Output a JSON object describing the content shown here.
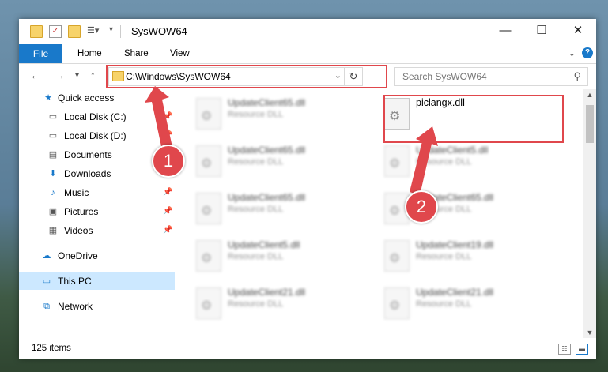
{
  "window": {
    "title": "SysWOW64"
  },
  "ribbon": {
    "tabs": [
      "File",
      "Home",
      "Share",
      "View"
    ]
  },
  "address": {
    "path": "C:\\Windows\\SysWOW64"
  },
  "search": {
    "placeholder": "Search SysWOW64"
  },
  "sidebar": {
    "items": [
      {
        "label": "Quick access",
        "icon": "star-icon"
      },
      {
        "label": "Local Disk (C:)",
        "icon": "drive-icon"
      },
      {
        "label": "Local Disk (D:)",
        "icon": "drive-icon"
      },
      {
        "label": "Documents",
        "icon": "document-icon"
      },
      {
        "label": "Downloads",
        "icon": "download-icon"
      },
      {
        "label": "Music",
        "icon": "music-icon"
      },
      {
        "label": "Pictures",
        "icon": "picture-icon"
      },
      {
        "label": "Videos",
        "icon": "video-icon"
      },
      {
        "label": "OneDrive",
        "icon": "cloud-icon"
      },
      {
        "label": "This PC",
        "icon": "computer-icon"
      },
      {
        "label": "Network",
        "icon": "network-icon"
      }
    ]
  },
  "files": [
    {
      "name": "UpdateClient65.dll",
      "type": "Resource DLL"
    },
    {
      "name": "piclangx.dll",
      "type": ""
    },
    {
      "name": "UpdateClient65.dll",
      "type": "Resource DLL"
    },
    {
      "name": "UpdateClient5.dll",
      "type": "Resource DLL"
    },
    {
      "name": "UpdateClient65.dll",
      "type": "Resource DLL"
    },
    {
      "name": "UpdateClient65.dll",
      "type": "Resource DLL"
    },
    {
      "name": "UpdateClient5.dll",
      "type": "Resource DLL"
    },
    {
      "name": "UpdateClient19.dll",
      "type": "Resource DLL"
    },
    {
      "name": "UpdateClient21.dll",
      "type": "Resource DLL"
    },
    {
      "name": "UpdateClient21.dll",
      "type": "Resource DLL"
    }
  ],
  "status": {
    "items": "125 items"
  },
  "annotations": {
    "badge1": "1",
    "badge2": "2",
    "color": "#e0474c"
  }
}
